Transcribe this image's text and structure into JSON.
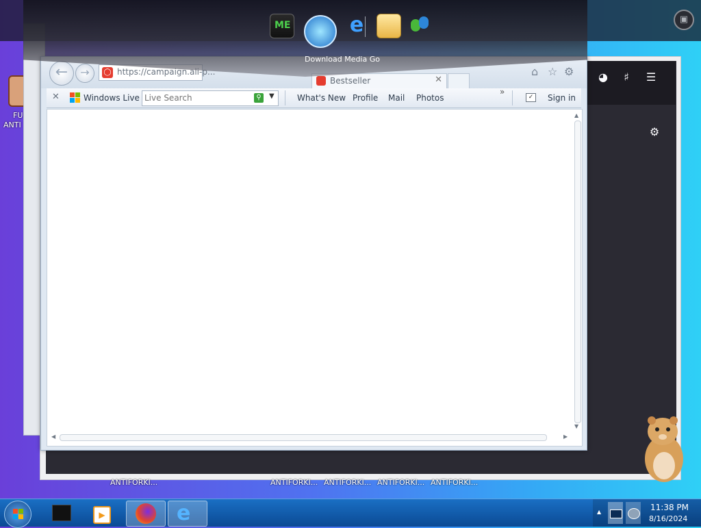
{
  "desktop": {
    "icon_label_line1": "FU",
    "icon_label_line2": "ANTI",
    "bottom_labels": [
      "ANTIFORKI...",
      "ANTIFORKI...",
      "ANTIFORKI...",
      "ANTIFORKI...",
      "ANTIFORKI..."
    ]
  },
  "dock": {
    "caption": "Download Media Go",
    "icons": [
      "media-app-icon",
      "media-go-icon",
      "internet-explorer-icon",
      "folder-icon",
      "messenger-icon"
    ]
  },
  "ie": {
    "address": "https://campaign.ali-p...",
    "tab_title": "Bestseller",
    "toolbar": {
      "brand": "Windows Live",
      "search_placeholder": "Live Search",
      "links": [
        "What's New",
        "Profile",
        "Mail",
        "Photos"
      ],
      "sign_in": "Sign in"
    }
  },
  "taskbar": {
    "time": "11:38 PM",
    "date": "8/16/2024"
  },
  "colors": {
    "taskbar": "#0b4a94",
    "dark_window": "#2b2a33",
    "ie_frame": "#dfe8f2"
  }
}
